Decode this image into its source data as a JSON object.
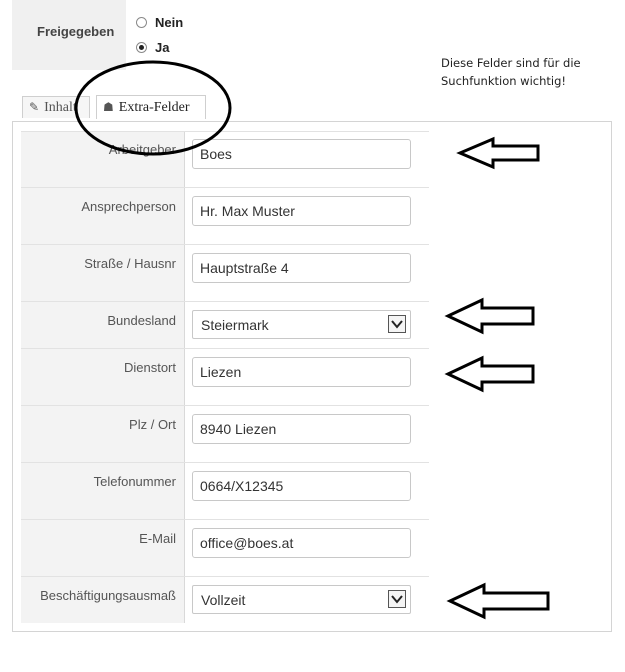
{
  "published": {
    "label": "Freigegeben",
    "options": [
      {
        "label": "Nein",
        "checked": false
      },
      {
        "label": "Ja",
        "checked": true
      }
    ]
  },
  "note": "Diese Felder sind für die Suchfunktion wichtig!",
  "tabs": [
    {
      "label": "Inhalt",
      "icon": "edit-icon",
      "active": false
    },
    {
      "label": "Extra-Felder",
      "icon": "puzzle-icon",
      "active": true
    }
  ],
  "fields": [
    {
      "label": "Arbeitgeber",
      "type": "text",
      "value": "Boes"
    },
    {
      "label": "Ansprechperson",
      "type": "text",
      "value": "Hr. Max Muster"
    },
    {
      "label": "Straße / Hausnr",
      "type": "text",
      "value": "Hauptstraße 4"
    },
    {
      "label": "Bundesland",
      "type": "select",
      "value": "Steiermark"
    },
    {
      "label": "Dienstort",
      "type": "text",
      "value": "Liezen"
    },
    {
      "label": "Plz / Ort",
      "type": "text",
      "value": "8940 Liezen"
    },
    {
      "label": "Telefonummer",
      "type": "text",
      "value": "0664/X12345"
    },
    {
      "label": "E-Mail",
      "type": "text",
      "value": "office@boes.at"
    },
    {
      "label": "Beschäftigungsausmaß",
      "type": "select",
      "value": "Vollzeit"
    }
  ],
  "annotation_color": "#000000"
}
